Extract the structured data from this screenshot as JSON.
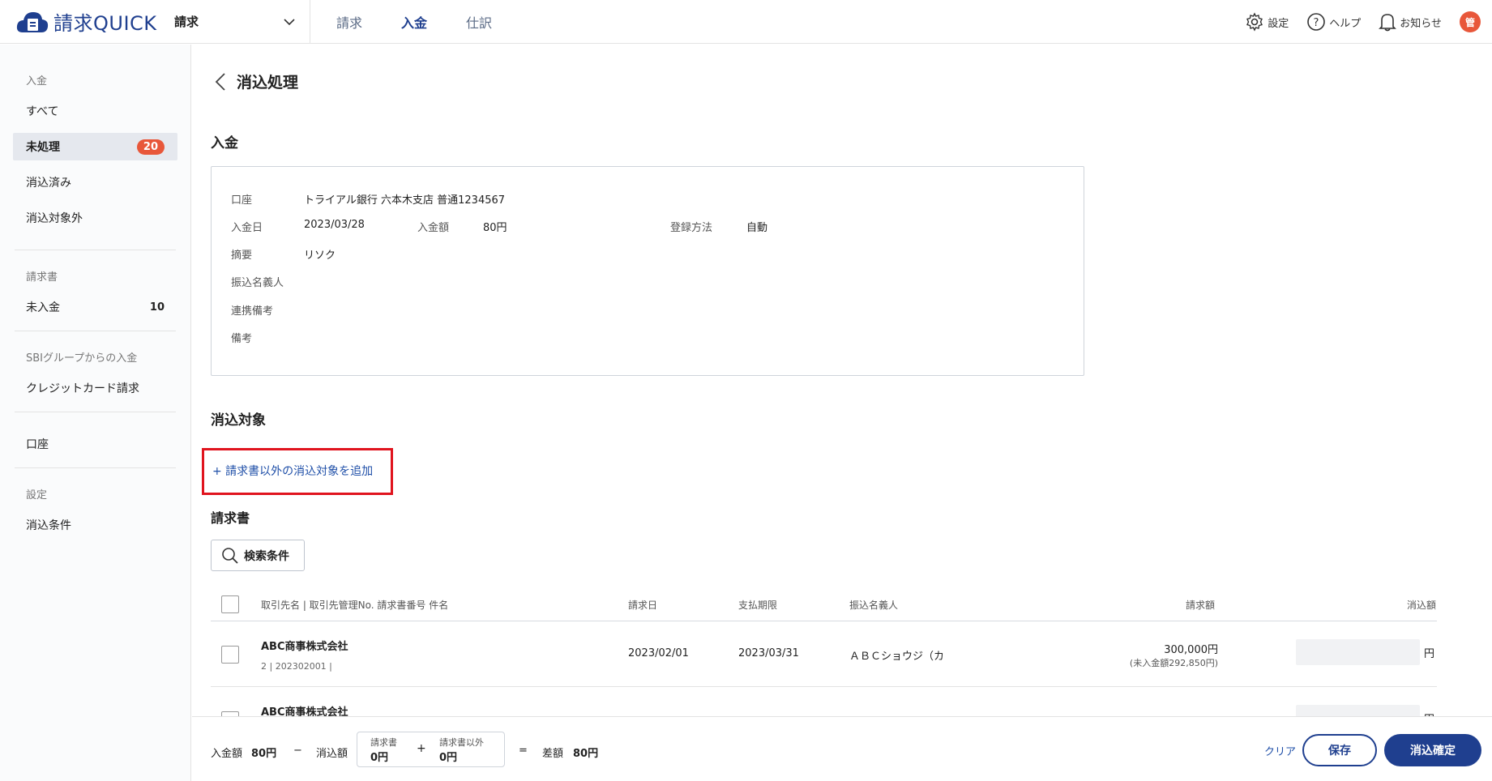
{
  "header": {
    "logo_text": "請求QUICK",
    "app_select": "請求",
    "nav": [
      "請求",
      "入金",
      "仕訳"
    ],
    "nav_active": 1,
    "settings": "設定",
    "help": "ヘルプ",
    "notifications": "お知らせ",
    "avatar": "管"
  },
  "sidebar": {
    "group1": {
      "heading": "入金",
      "items": [
        "すべて",
        "未処理",
        "消込済み",
        "消込対象外"
      ],
      "badge": "20"
    },
    "group2": {
      "heading": "請求書",
      "item": "未入金",
      "count": "10"
    },
    "group3": {
      "heading": "SBIグループからの入金",
      "item": "クレジットカード請求"
    },
    "group4": {
      "item": "口座"
    },
    "group5": {
      "heading": "設定",
      "item": "消込条件"
    }
  },
  "page": {
    "title": "消込処理",
    "deposit_section": "入金",
    "info": {
      "account_label": "口座",
      "account_value": "トライアル銀行 六本木支店 普通1234567",
      "date_label": "入金日",
      "date_value": "2023/03/28",
      "amount_label": "入金額",
      "amount_value": "80円",
      "method_label": "登録方法",
      "method_value": "自動",
      "summary_label": "摘要",
      "summary_value": "リソク",
      "payer_label": "振込名義人",
      "link_note_label": "連携備考",
      "note_label": "備考"
    },
    "target_section": "消込対象",
    "add_link": "+ 請求書以外の消込対象を追加",
    "invoice_section": "請求書",
    "search_button": "検索条件"
  },
  "table": {
    "headers": {
      "client": "取引先名 | 取引先管理No.  請求書番号  件名",
      "invoice_date": "請求日",
      "due_date": "支払期限",
      "payer": "振込名義人",
      "billed": "請求額",
      "applied": "消込額"
    },
    "rows": [
      {
        "client": "ABC商事株式会社",
        "sub": "2 | 202302001 |",
        "invoice_date": "2023/02/01",
        "due_date": "2023/03/31",
        "payer": "ＡＢＣショウジ（カ",
        "billed": "300,000円",
        "unpaid": "(未入金額292,850円)",
        "unit": "円"
      },
      {
        "client": "ABC商事株式会社",
        "sub": "",
        "invoice_date": "",
        "due_date": "",
        "payer": "",
        "billed": "",
        "unpaid": "",
        "unit": "円"
      }
    ]
  },
  "footer": {
    "deposit_label": "入金額",
    "deposit_value": "80円",
    "minus": "−",
    "applied_label": "消込額",
    "invoice_label": "請求書",
    "invoice_value": "0円",
    "plus": "+",
    "other_label": "請求書以外",
    "other_value": "0円",
    "equals": "=",
    "diff_label": "差額",
    "diff_value": "80円",
    "clear": "クリア",
    "save": "保存",
    "confirm": "消込確定"
  }
}
